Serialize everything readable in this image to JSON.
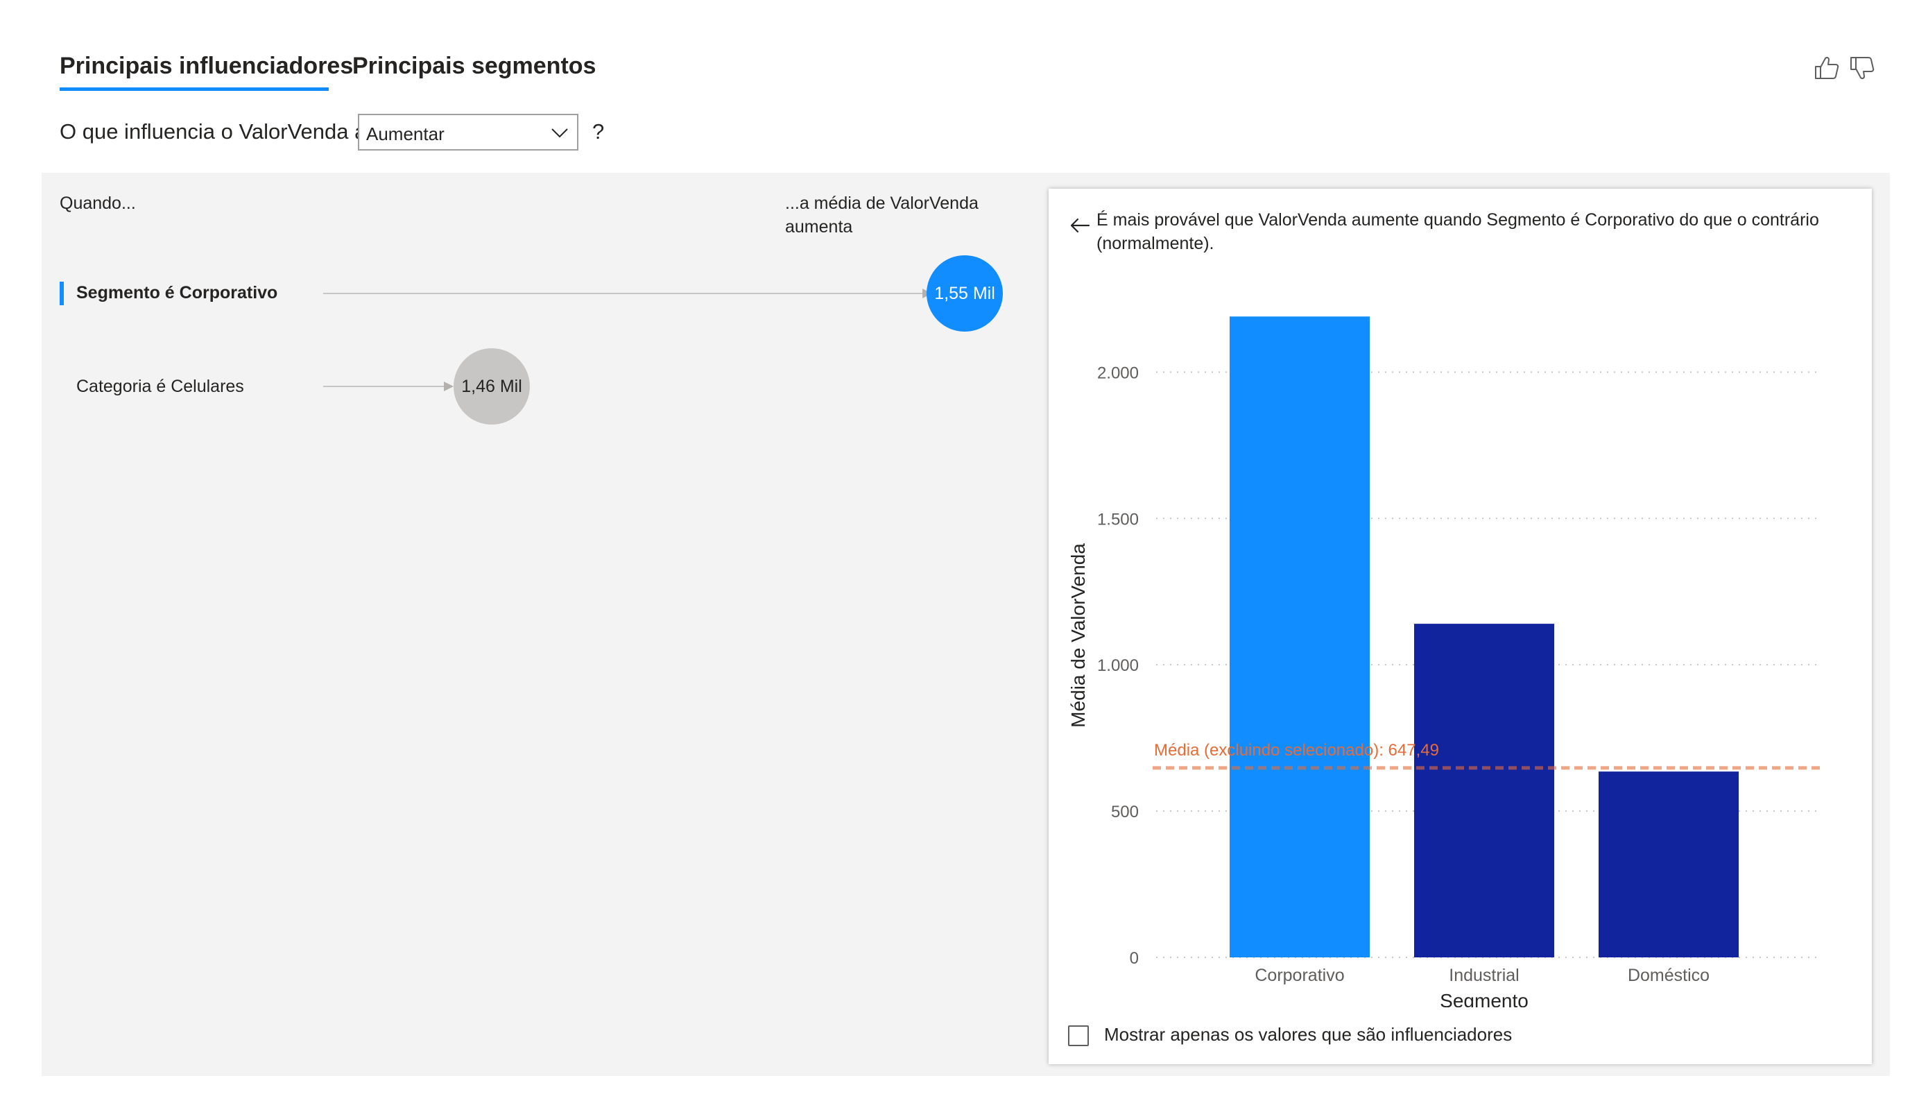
{
  "tabs": [
    {
      "label": "Principais influenciadores",
      "active": true
    },
    {
      "label": "Principais segmentos",
      "active": false
    }
  ],
  "icons": {
    "thumbs_up": "thumbs-up-icon",
    "thumbs_down": "thumbs-down-icon",
    "back": "arrow-left-icon",
    "dropdown": "chevron-down-icon"
  },
  "question": {
    "prefix": "O que influencia o ValorVenda a",
    "dropdown_value": "Aumentar",
    "suffix": "?"
  },
  "left_panel": {
    "header_when": "Quando...",
    "header_avg_line1": "...a média de ValorVenda",
    "header_avg_line2": "aumenta",
    "influencers": [
      {
        "label": "Segmento é Corporativo",
        "value_label": "1,55 Mil",
        "selected": true
      },
      {
        "label": "Categoria é Celulares",
        "value_label": "1,46 Mil",
        "selected": false
      }
    ]
  },
  "detail": {
    "description_line1": "É mais provável que ValorVenda aumente quando Segmento é Corporativo do que o contrário",
    "description_line2": "(normalmente).",
    "checkbox_label": "Mostrar apenas os valores que são influenciadores",
    "checkbox_checked": false
  },
  "colors": {
    "accent": "#118dff",
    "bar_selected": "#118dff",
    "bar_other": "#12239e",
    "average_line": "#e66c37",
    "bubble_other": "#c8c6c4",
    "panel_bg": "#f3f3f3"
  },
  "chart_data": {
    "type": "bar",
    "categories": [
      "Corporativo",
      "Industrial",
      "Doméstico"
    ],
    "values": [
      2190,
      1140,
      635
    ],
    "selected_index": 0,
    "xlabel": "Segmento",
    "ylabel": "Média de ValorVenda",
    "ylim": [
      0,
      2200
    ],
    "yticks": [
      0,
      500,
      1000,
      1500,
      2000
    ],
    "ytick_labels": [
      "0",
      "500",
      "1.000",
      "1.500",
      "2.000"
    ],
    "grid": true,
    "average_line": {
      "value": 647.49,
      "label": "Média (excluindo selecionado): 647,49"
    }
  }
}
